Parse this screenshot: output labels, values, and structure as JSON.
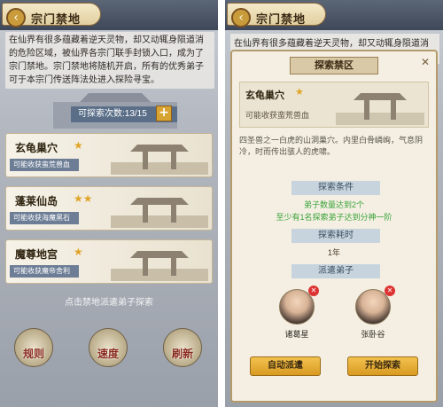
{
  "left": {
    "title": "宗门禁地",
    "back_icon": "back-arrow-icon",
    "intro": "在仙界有很多蕴藏着逆天灵物，却又动辄身陨道消的危险区域，被仙界各宗门联手封锁入口，成为了宗门禁地。宗门禁地将随机开启，所有的优秀弟子可于本宗门传送阵法处进入探险寻宝。",
    "explore_count_label": "可探索次数:",
    "explore_count": "13/15",
    "plus_label": "+",
    "cards": [
      {
        "name": "玄龟巢穴",
        "stars": "★",
        "sub": "可能收获蛮荒兽血"
      },
      {
        "name": "蓬莱仙岛",
        "stars": "★★",
        "sub": "可能收获海魔黑石"
      },
      {
        "name": "魔尊地宫",
        "stars": "★",
        "sub": "可能收获魔帝舍利"
      }
    ],
    "hint": "点击禁地派遣弟子探索",
    "bottom_buttons": [
      {
        "label": "规则",
        "icon": "scroll-icon"
      },
      {
        "label": "速度",
        "icon": "boot-icon"
      },
      {
        "label": "刷新",
        "icon": "refresh-icon"
      }
    ]
  },
  "right": {
    "title": "宗门禁地",
    "intro": "在仙界有很多蕴藏着逆天灵物，却又动辄身陨道消的",
    "modal": {
      "header": "探索禁区",
      "close_icon": "close-icon",
      "card_name": "玄龟巢穴",
      "card_stars": "★",
      "card_sub": "可能收获蛮荒兽血",
      "description": "四圣兽之一白虎的山洞巢穴。内里白骨嶙峋，气息阴冷，时而传出骇人的虎啸。",
      "conditions_header": "探索条件",
      "condition_1": "弟子数量达到2个",
      "condition_2": "至少有1名探索弟子达到分神一阶",
      "time_header": "探索耗时",
      "time_value": "1年",
      "dispatch_header": "派遣弟子",
      "disciples": [
        {
          "name": "诸葛星"
        },
        {
          "name": "张卧谷"
        }
      ],
      "auto_button": "自动派遣",
      "start_button": "开始探索"
    }
  },
  "colors": {
    "accent_gold": "#d99a22",
    "condition_green": "#3aa33a",
    "remove_red": "#d33333"
  }
}
